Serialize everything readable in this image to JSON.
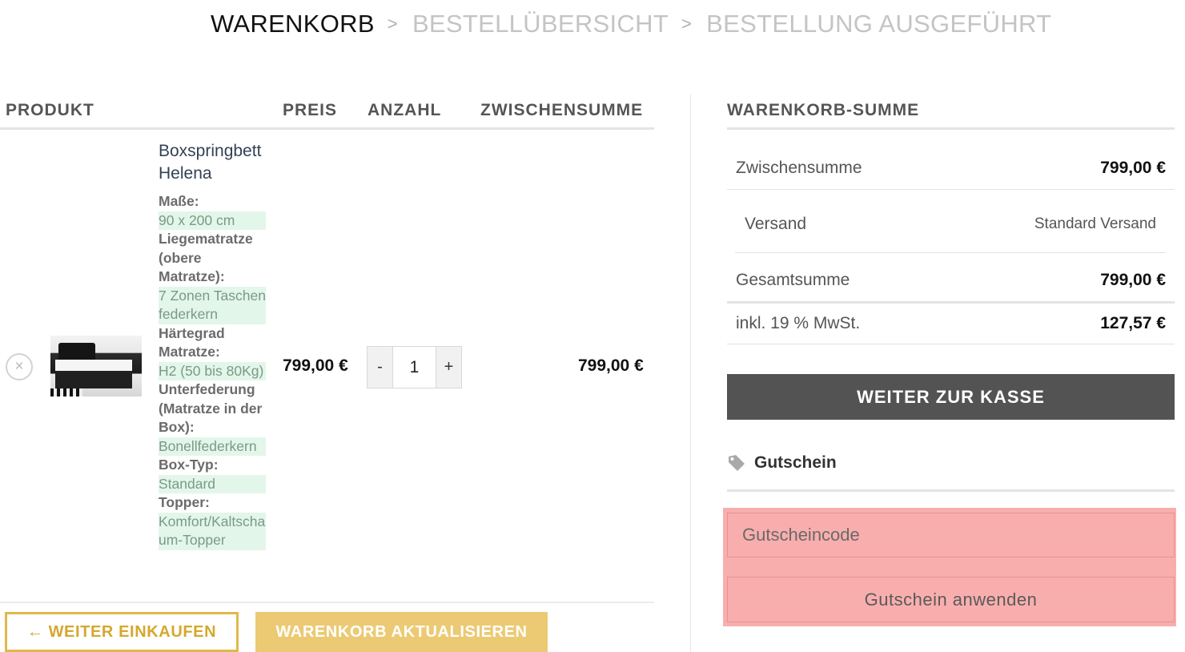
{
  "breadcrumb": {
    "steps": [
      "WARENKORB",
      "BESTELLÜBERSICHT",
      "BESTELLUNG AUSGEFÜHRT"
    ],
    "separator": ">"
  },
  "cart_table": {
    "headers": {
      "product": "PRODUKT",
      "price": "PREIS",
      "quantity": "ANZAHL",
      "subtotal": "ZWISCHENSUMME"
    },
    "item": {
      "remove_symbol": "×",
      "name": "Boxspringbett Helena",
      "variations": [
        {
          "label": "Maße:",
          "value": "90 x 200 cm"
        },
        {
          "label": "Liegematratze (obere Matratze):",
          "value": "7 Zonen Taschenfederkern"
        },
        {
          "label": "Härtegrad Matratze:",
          "value": "H2 (50 bis 80Kg)"
        },
        {
          "label": "Unterfederung (Matratze in der Box):",
          "value": "Bonellfederkern"
        },
        {
          "label": "Box-Typ:",
          "value": "Standard"
        },
        {
          "label": "Topper:",
          "value": "Komfort/Kaltschaum-Topper"
        }
      ],
      "price": "799,00 €",
      "quantity": "1",
      "minus": "-",
      "plus": "+",
      "subtotal": "799,00 €"
    },
    "continue_shopping": "← WEITER EINKAUFEN",
    "update_cart": "WARENKORB AKTUALISIEREN"
  },
  "totals": {
    "title": "WARENKORB-SUMME",
    "subtotal_label": "Zwischensumme",
    "subtotal_value": "799,00 €",
    "shipping_label": "Versand",
    "shipping_value": "Standard Versand",
    "total_label": "Gesamtsumme",
    "total_value": "799,00 €",
    "tax_label": "inkl. 19 % MwSt.",
    "tax_value": "127,57 €",
    "checkout_button": "WEITER ZUR KASSE"
  },
  "coupon": {
    "title": "Gutschein",
    "placeholder": "Gutscheincode",
    "apply_button": "Gutschein anwenden"
  },
  "colors": {
    "accent_gold": "#e0b94c",
    "checkout_bg": "#535353",
    "highlight": "#f9aeae",
    "variation_bg": "#e3f6ea"
  },
  "icons": {
    "remove": "close-circle-icon",
    "coupon": "tag-icon",
    "separator": "chevron-right-icon"
  }
}
